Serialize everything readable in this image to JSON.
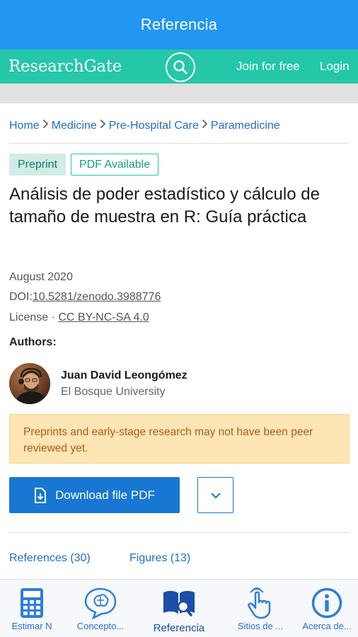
{
  "appbar": {
    "title": "Referencia"
  },
  "site_header": {
    "logo": "ResearchGate",
    "search_icon": "search-icon",
    "join_label": "Join for free",
    "login_label": "Login"
  },
  "breadcrumb": [
    "Home",
    "Medicine",
    "Pre-Hospital Care",
    "Paramedicine"
  ],
  "badges": {
    "preprint": "Preprint",
    "pdf": "PDF Available"
  },
  "publication": {
    "title": "Análisis de poder estadístico y cálculo de tamaño de muestra en R: Guía práctica",
    "date": "August 2020",
    "doi_label": "DOI:",
    "doi_value": "10.5281/zenodo.3988776",
    "license_label": "License ·",
    "license_value": "CC BY-NC-SA 4.0"
  },
  "authors": {
    "label": "Authors:",
    "list": [
      {
        "name": "Juan David Leongómez",
        "institution": "El Bosque University"
      }
    ]
  },
  "notice": "Preprints and early-stage research may not have been peer reviewed yet.",
  "actions": {
    "download_label": "Download file PDF",
    "download_icon": "file-download-icon",
    "more_icon": "chevron-down-icon"
  },
  "tabs": {
    "references": "References (30)",
    "figures": "Figures (13)"
  },
  "bottom_nav": {
    "items": [
      {
        "label": "Estimar N",
        "icon": "calculator-icon"
      },
      {
        "label": "Concepto...",
        "icon": "brain-bubble-icon"
      },
      {
        "label": "Referencia",
        "icon": "book-search-icon",
        "active": true
      },
      {
        "label": "Sitios de ...",
        "icon": "touch-hand-icon"
      },
      {
        "label": "Acerca de...",
        "icon": "info-icon"
      }
    ]
  },
  "colors": {
    "appbar": "#2196f3",
    "researchgate": "#24c7a8",
    "link": "#1f6fc5",
    "primary_button": "#1877d2",
    "notice_bg": "#fde6b4",
    "notice_text": "#b15a18"
  }
}
